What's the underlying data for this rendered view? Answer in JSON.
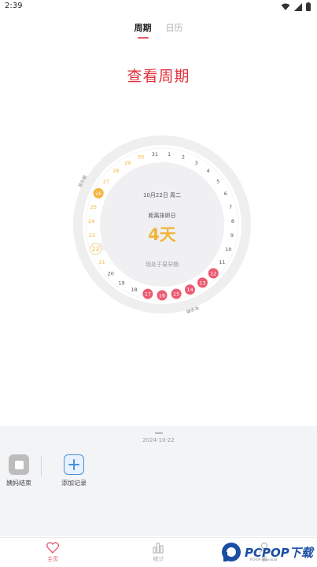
{
  "status_bar": {
    "time": "2:39"
  },
  "tabs": [
    {
      "label": "周期",
      "active": true
    },
    {
      "label": "日历",
      "active": false
    }
  ],
  "page_title": "查看周期",
  "cycle": {
    "date": "10月22日 周二",
    "ovulation_label": "距离排卵日",
    "days_left": "4天",
    "phase": "现处于易孕期",
    "today": 22,
    "period_days": [
      12,
      13,
      14,
      15,
      16,
      17
    ],
    "fertile_days": [
      21,
      22,
      23,
      24,
      25,
      26,
      27,
      28,
      29,
      30
    ],
    "fertile_label": "易孕期",
    "safe_label": "安全期",
    "colors": {
      "period": "#ec5b72",
      "fertile": "#f2b53c",
      "normal": "#555555",
      "ring": "#efefef"
    }
  },
  "panel": {
    "date": "2024-10-22",
    "actions": [
      {
        "label": "姨妈结束",
        "icon": "stop-icon"
      },
      {
        "label": "添加记录",
        "icon": "plus-icon"
      }
    ]
  },
  "nav": [
    {
      "label": "主页",
      "icon": "heart-icon",
      "active": true
    },
    {
      "label": "统计",
      "icon": "bar-chart-icon",
      "active": false
    },
    {
      "label": "我",
      "icon": "user-icon",
      "active": false
    }
  ],
  "watermark": {
    "text": "PCPOP下载",
    "sub": "PCPOP Download"
  }
}
